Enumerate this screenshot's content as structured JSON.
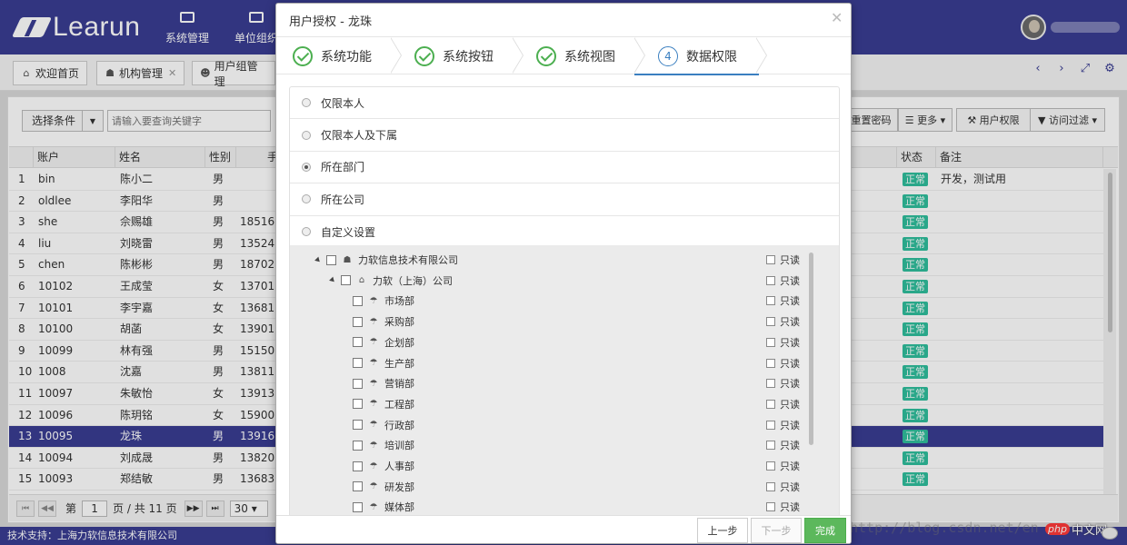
{
  "app": {
    "logo_text": "Learun",
    "nav": [
      {
        "label": "系统管理",
        "icon": "monitor-icon"
      },
      {
        "label": "单位组织",
        "icon": "coffee-icon"
      }
    ]
  },
  "tabs": [
    {
      "label": "欢迎首页",
      "icon": "home-icon",
      "closable": false
    },
    {
      "label": "机构管理",
      "icon": "sitemap-icon",
      "closable": true
    },
    {
      "label": "用户组管理",
      "icon": "users-icon",
      "closable": false
    }
  ],
  "toolbar": {
    "select_condition": "选择条件",
    "search_placeholder": "请输入要查询关键字",
    "reset_password": "重置密码",
    "more": "更多",
    "user_permission": "用户权限",
    "access_filter": "访问过滤"
  },
  "grid": {
    "headers": {
      "account": "账户",
      "name": "姓名",
      "gender": "性别",
      "phone": "手",
      "status": "状态",
      "remark": "备注"
    },
    "rows": [
      {
        "no": "1",
        "account": "bin",
        "name": "陈小二",
        "gender": "男",
        "phone": "",
        "status": "正常",
        "remark": "开发，测试用"
      },
      {
        "no": "2",
        "account": "oldlee",
        "name": "李阳华",
        "gender": "男",
        "phone": "",
        "status": "正常",
        "remark": ""
      },
      {
        "no": "3",
        "account": "she",
        "name": "佘赐雄",
        "gender": "男",
        "phone": "18516",
        "status": "正常",
        "remark": ""
      },
      {
        "no": "4",
        "account": "liu",
        "name": "刘晓雷",
        "gender": "男",
        "phone": "13524",
        "status": "正常",
        "remark": ""
      },
      {
        "no": "5",
        "account": "chen",
        "name": "陈彬彬",
        "gender": "男",
        "phone": "18702",
        "status": "正常",
        "remark": ""
      },
      {
        "no": "6",
        "account": "10102",
        "name": "王成莹",
        "gender": "女",
        "phone": "13701",
        "status": "正常",
        "remark": ""
      },
      {
        "no": "7",
        "account": "10101",
        "name": "李宇嘉",
        "gender": "女",
        "phone": "13681",
        "status": "正常",
        "remark": ""
      },
      {
        "no": "8",
        "account": "10100",
        "name": "胡菡",
        "gender": "女",
        "phone": "13901",
        "status": "正常",
        "remark": ""
      },
      {
        "no": "9",
        "account": "10099",
        "name": "林有强",
        "gender": "男",
        "phone": "15150",
        "status": "正常",
        "remark": ""
      },
      {
        "no": "10",
        "account": "1008",
        "name": "沈嘉",
        "gender": "男",
        "phone": "13811",
        "status": "正常",
        "remark": ""
      },
      {
        "no": "11",
        "account": "10097",
        "name": "朱敏怡",
        "gender": "女",
        "phone": "13913",
        "status": "正常",
        "remark": ""
      },
      {
        "no": "12",
        "account": "10096",
        "name": "陈玥铭",
        "gender": "女",
        "phone": "15900",
        "status": "正常",
        "remark": ""
      },
      {
        "no": "13",
        "account": "10095",
        "name": "龙珠",
        "gender": "男",
        "phone": "13916",
        "status": "正常",
        "remark": "",
        "selected": true
      },
      {
        "no": "14",
        "account": "10094",
        "name": "刘成晟",
        "gender": "男",
        "phone": "13820",
        "status": "正常",
        "remark": ""
      },
      {
        "no": "15",
        "account": "10093",
        "name": "郑结敏",
        "gender": "男",
        "phone": "13683",
        "status": "正常",
        "remark": ""
      }
    ]
  },
  "pager": {
    "prefix": "第",
    "page": "1",
    "suffix": "页 / 共 11 页",
    "page_size": "30"
  },
  "footer": {
    "text": "技术支持：上海力软信息技术有限公司"
  },
  "watermark": "http://blog.csdn.net/en",
  "php_logo": {
    "badge": "php",
    "text": "中文网"
  },
  "modal": {
    "title": "用户授权 - 龙珠",
    "steps": [
      {
        "label": "系统功能",
        "state": "done"
      },
      {
        "label": "系统按钮",
        "state": "done"
      },
      {
        "label": "系统视图",
        "state": "done"
      },
      {
        "label": "数据权限",
        "state": "active",
        "number": "4"
      }
    ],
    "options": [
      {
        "label": "仅限本人",
        "checked": false
      },
      {
        "label": "仅限本人及下属",
        "checked": false
      },
      {
        "label": "所在部门",
        "checked": true
      },
      {
        "label": "所在公司",
        "checked": false
      },
      {
        "label": "自定义设置",
        "checked": false
      }
    ],
    "tree": {
      "readonly_label": "只读",
      "root": "力软信息技术有限公司",
      "company": "力软（上海）公司",
      "departments": [
        "市场部",
        "采购部",
        "企划部",
        "生产部",
        "营销部",
        "工程部",
        "行政部",
        "培训部",
        "人事部",
        "研发部",
        "媒体部"
      ]
    },
    "buttons": {
      "prev": "上一步",
      "next": "下一步",
      "finish": "完成"
    }
  }
}
